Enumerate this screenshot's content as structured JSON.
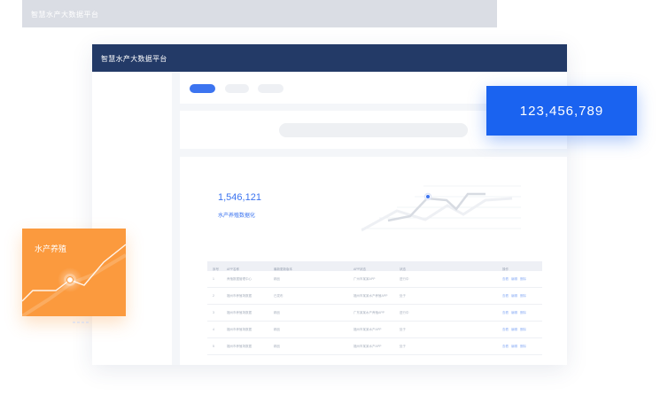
{
  "background_window": {
    "title": "智慧水产大数据平台"
  },
  "main_window": {
    "title": "智慧水产大数据平台",
    "stat": {
      "value": "1,546,121",
      "label": "水产养殖数据化"
    },
    "table": {
      "headers": [
        "序号",
        "APP名称",
        "最新更新版本",
        "APP状态",
        "状态",
        "操作"
      ],
      "rows": [
        [
          "1",
          "养殖数据管理中心",
          "精品",
          "广州市某某APP",
          "进行中",
          [
            "查看",
            "编辑",
            "删除"
          ]
        ],
        [
          "2",
          "福州市养殖场数据",
          "已发布",
          "福州市某某水产养殖APP",
          "处于",
          [
            "查看",
            "编辑",
            "删除"
          ]
        ],
        [
          "3",
          "福州市养殖场数据",
          "精品",
          "广东某某水产养殖APP",
          "进行中",
          [
            "查看",
            "编辑",
            "删除"
          ]
        ],
        [
          "4",
          "福州市养殖场数据",
          "精品",
          "福州市某某水产APP",
          "处于",
          [
            "查看",
            "编辑",
            "删除"
          ]
        ],
        [
          "5",
          "福州市养殖场数据",
          "精品",
          "福州市某某水产APP",
          "处于",
          [
            "查看",
            "编辑",
            "删除"
          ]
        ]
      ]
    }
  },
  "counter_card": {
    "value": "123,456,789"
  },
  "orange_card": {
    "title": "水产养殖"
  },
  "colors": {
    "navy": "#233a67",
    "accent": "#3c74f0",
    "counter_blue": "#1a63f0",
    "orange": "#fb9a3e"
  }
}
